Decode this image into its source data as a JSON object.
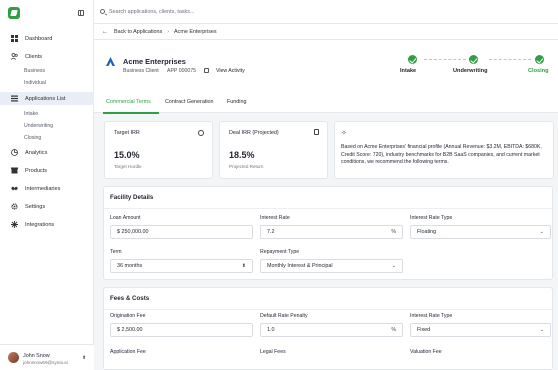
{
  "sidebar": {
    "items": [
      {
        "label": "Dashboard"
      },
      {
        "label": "Clients"
      },
      {
        "label": "Applications List"
      },
      {
        "label": "Analytics"
      },
      {
        "label": "Products"
      },
      {
        "label": "Intermediaries"
      },
      {
        "label": "Settings"
      },
      {
        "label": "Integrations"
      }
    ],
    "clients_sub": [
      "Business",
      "Individual"
    ],
    "applications_sub": [
      "Intake",
      "Underwriting",
      "Closing"
    ],
    "user": {
      "name": "John Snow",
      "email": "johnsnow69@synia.ai"
    }
  },
  "search": {
    "placeholder": "Search applications, clients, tasks..."
  },
  "breadcrumb": {
    "back": "Back to Applications",
    "current": "Acme Enterprises"
  },
  "header": {
    "company": "Acme Enterprises",
    "type": "Business Client",
    "app_id": "APP 000075",
    "view_activity": "View Activity"
  },
  "stages": [
    "Intake",
    "Underwriting",
    "Closing"
  ],
  "tabs": [
    "Commercial Terms",
    "Contract Generation",
    "Funding"
  ],
  "cards": {
    "target_irr": {
      "label": "Target IRR",
      "value": "15.0%",
      "sub": "Target Hurdle"
    },
    "deal_irr": {
      "label": "Deal IRR (Projected)",
      "value": "18.5%",
      "sub": "Projected Return"
    },
    "ai_summary": "Based on Acme Enterprises' financial profile (Annual Revenue: $3.2M, EBITDA: $680K, Credit Score: 720), industry benchmarks for B2B SaaS companies, and current market conditions, we recommend the following terms."
  },
  "facility": {
    "title": "Facility Details",
    "loan_amount_label": "Loan Amount",
    "loan_amount": "$ 250,000.00",
    "interest_rate_label": "Interest Rate",
    "interest_rate": "7.2",
    "interest_type_label": "Interest Rate Type",
    "interest_type": "Floating",
    "term_label": "Term",
    "term": "36 months",
    "repayment_label": "Repayment Type",
    "repayment": "Monthly Interest & Principal"
  },
  "fees": {
    "title": "Fees & Costs",
    "origination_label": "Origination Fee",
    "origination": "$ 2,500.00",
    "default_rate_label": "Default Rate Penalty",
    "default_rate": "1.0",
    "interest_type_label": "Interest Rate Type",
    "interest_type": "Fixed",
    "application_fee_label": "Application Fee",
    "legal_fees_label": "Legal Fees",
    "valuation_fee_label": "Valuation Fee"
  },
  "percent": "%",
  "colors": {
    "accent": "#2f9e44",
    "background": "#f4f5f7"
  }
}
